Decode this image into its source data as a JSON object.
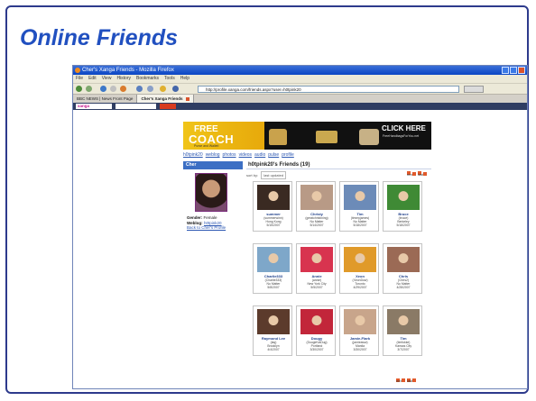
{
  "slide": {
    "title": "Online Friends",
    "accent_color": "#2150c0",
    "border_color": "#2d3a8c"
  },
  "browser": {
    "window_title": "Cher's Xanga Friends - Mozilla Firefox",
    "menu_items": [
      "File",
      "Edit",
      "View",
      "History",
      "Bookmarks",
      "Tools",
      "Help"
    ],
    "address": "http://profile.xanga.com/friends.aspx?user=h0tpink20",
    "tabs": [
      {
        "label": "BBC NEWS | News Front Page",
        "active": false
      },
      {
        "label": "Cher's Xanga Friends",
        "active": true
      }
    ],
    "site_logo": "xanga"
  },
  "ad": {
    "left_headline": "FREE",
    "left_brand": "COACH",
    "left_sub": "Purse and Wallet!",
    "right_headline": "CLICK HERE",
    "right_sub": "FreeHandbagsForYou.net"
  },
  "subnav": [
    "h0tpink20",
    "weblog",
    "photos",
    "videos",
    "audio",
    "pulse",
    "profile"
  ],
  "profile": {
    "header": "Cher",
    "gender_label": "Gender:",
    "gender": "Female",
    "weblog_label": "Weblog:",
    "weblog": "h0tpink20",
    "back_link": "Back to Cher's Profile"
  },
  "friends_header": "h0tpink20's Friends (19)",
  "sort": {
    "label": "sort by:",
    "value": "last updated",
    "next_label": "next",
    "last_label": "last"
  },
  "friends": [
    {
      "name": "summer",
      "detail": "(summerwinn)\nHong Kong\n5/15/2007",
      "photo": "#3a2a22"
    },
    {
      "name": "Christy",
      "detail": "(greatchristining)\nNo Matter\n5/14/2007",
      "photo": "#b89a86"
    },
    {
      "name": "Tim",
      "detail": "(timmyjames)\nNo Matter\n5/18/2007",
      "photo": "#6c8bb8"
    },
    {
      "name": "Bruce",
      "detail": "(bruce)\nBerkeley\n5/18/2007",
      "photo": "#3f8a35"
    },
    {
      "name": "Charlie333",
      "detail": "(Charlie333)\nNo Matter\n5/8/2007",
      "photo": "#7ea7c9"
    },
    {
      "name": "Annie",
      "detail": "(annie)\nNew York City\n5/5/2007",
      "photo": "#d8344f"
    },
    {
      "name": "Xeon",
      "detail": "(XeonDow)\nToronto\n4/29/2007",
      "photo": "#e09a2a"
    },
    {
      "name": "Chris",
      "detail": "(Chris2)\nNo Matter\n4/28/2007",
      "photo": "#9b6a55"
    },
    {
      "name": "Raymond Lee",
      "detail": "(laq)\nBrooklyn\n4/4/2007",
      "photo": "#5c3b2c"
    },
    {
      "name": "Dougy",
      "detail": "(DougieVaDug)\nPortland\n3/30/2007",
      "photo": "#c2263a"
    },
    {
      "name": "Jamie-Flark",
      "detail": "(jamieaww)\nManila\n3/30/2007",
      "photo": "#c8a58b"
    },
    {
      "name": "Tim",
      "detail": "(timfukke)\nKansas City\n3/7/2007",
      "photo": "#8a7a66"
    }
  ]
}
